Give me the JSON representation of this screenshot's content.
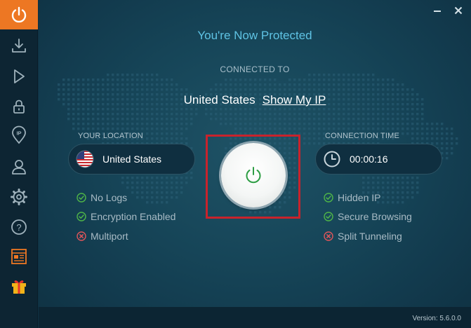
{
  "colors": {
    "accent": "#ed7723",
    "headline": "#5fc3e4",
    "protected_green": "#2e9e44",
    "highlight_red": "#c8232c"
  },
  "sidebar": {
    "items": [
      {
        "icon": "power-icon",
        "active": true
      },
      {
        "icon": "download-icon"
      },
      {
        "icon": "play-icon"
      },
      {
        "icon": "lock-icon"
      },
      {
        "icon": "ip-location-icon",
        "text": "IP"
      },
      {
        "icon": "user-icon"
      },
      {
        "icon": "gear-icon"
      },
      {
        "icon": "help-icon",
        "text": "?"
      },
      {
        "icon": "news-icon"
      },
      {
        "icon": "gift-icon"
      }
    ]
  },
  "window": {
    "minimize": "minimize-icon",
    "close": "close-icon"
  },
  "status": {
    "headline": "You're Now Protected",
    "connected_to_label": "CONNECTED TO",
    "location": "United States",
    "show_ip": "Show My IP"
  },
  "your_location": {
    "label": "YOUR LOCATION",
    "country": "United States",
    "flag_icon": "us-flag-icon"
  },
  "connection_time": {
    "label": "CONNECTION TIME",
    "value": "00:00:16",
    "icon": "clock-icon"
  },
  "features_left": [
    {
      "label": "No Logs",
      "enabled": true
    },
    {
      "label": "Encryption Enabled",
      "enabled": true
    },
    {
      "label": "Multiport",
      "enabled": false
    }
  ],
  "features_right": [
    {
      "label": "Hidden IP",
      "enabled": true
    },
    {
      "label": "Secure Browsing",
      "enabled": true
    },
    {
      "label": "Split Tunneling",
      "enabled": false
    }
  ],
  "footer": {
    "version": "Version:  5.6.0.0"
  }
}
